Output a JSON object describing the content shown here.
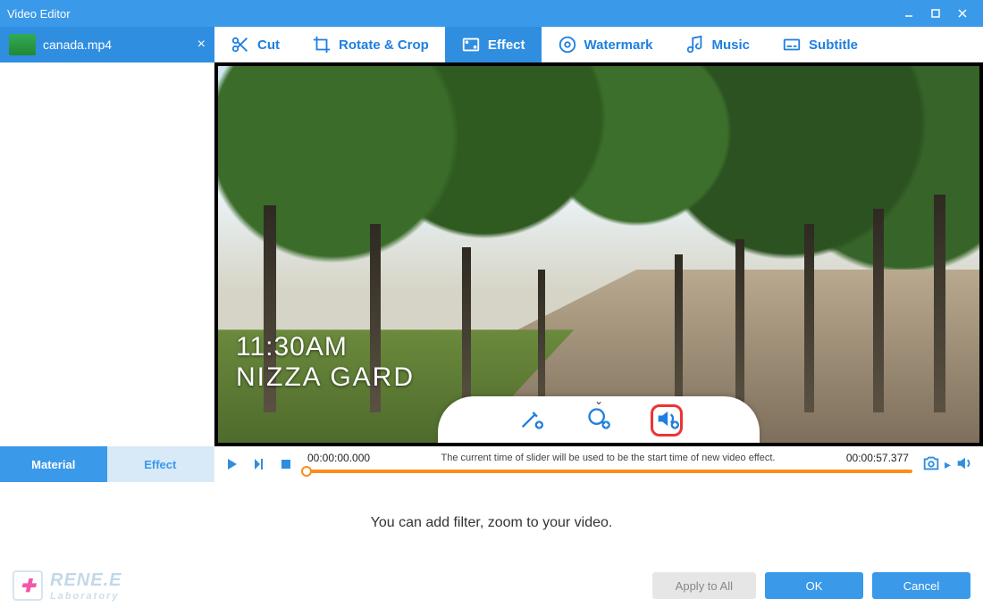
{
  "window": {
    "title": "Video Editor"
  },
  "file": {
    "name": "canada.mp4"
  },
  "tabs": {
    "cut": "Cut",
    "rotate": "Rotate & Crop",
    "effect": "Effect",
    "watermark": "Watermark",
    "music": "Music",
    "subtitle": "Subtitle",
    "active": "effect"
  },
  "sidebar_tabs": {
    "material": "Material",
    "effect": "Effect"
  },
  "video_overlay": {
    "line1": "11:30AM",
    "line2": "NIZZA GARD"
  },
  "timeline": {
    "start": "00:00:00.000",
    "end": "00:00:57.377",
    "hint": "The current time of slider will be used to be the start time of new video effect."
  },
  "bottom": {
    "info": "You can add filter, zoom to your video.",
    "apply_all": "Apply to All",
    "ok": "OK",
    "cancel": "Cancel",
    "brand_main": "RENE.E",
    "brand_sub": "Laboratory"
  },
  "icons": {
    "popover": [
      "wand",
      "zoom",
      "audio"
    ],
    "highlighted": "audio"
  }
}
